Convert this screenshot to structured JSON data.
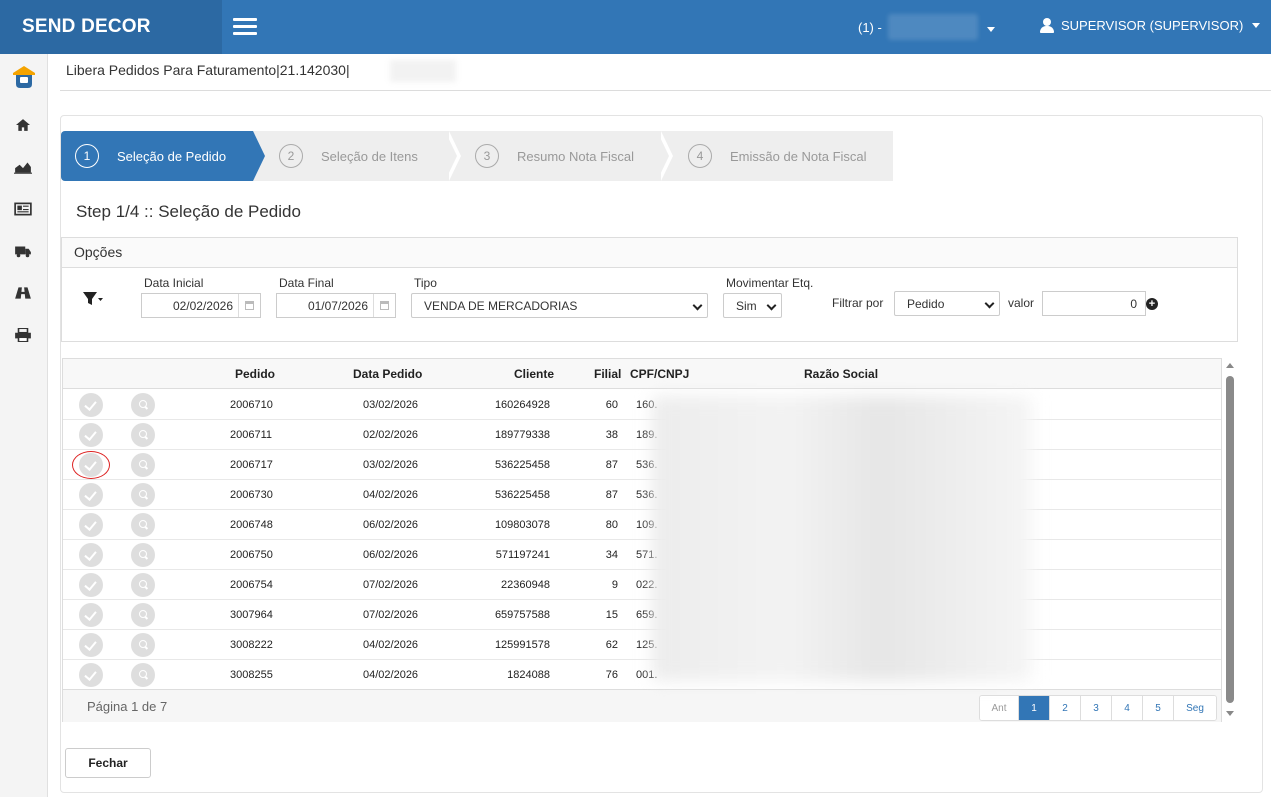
{
  "app": {
    "brand": "SEND DECOR"
  },
  "header": {
    "company_prefix": "(1) -",
    "user": "SUPERVISOR (SUPERVISOR)"
  },
  "page": {
    "title": "Libera Pedidos Para Faturamento|21.142030|"
  },
  "wizard": {
    "steps": [
      {
        "num": "1",
        "label": "Seleção de Pedido",
        "active": true
      },
      {
        "num": "2",
        "label": "Seleção de Itens",
        "active": false
      },
      {
        "num": "3",
        "label": "Resumo Nota Fiscal",
        "active": false
      },
      {
        "num": "4",
        "label": "Emissão de Nota Fiscal",
        "active": false
      }
    ],
    "heading": "Step 1/4 :: Seleção de Pedido"
  },
  "options": {
    "title": "Opções",
    "data_inicial_label": "Data Inicial",
    "data_inicial": "02/02/2026",
    "data_final_label": "Data Final",
    "data_final": "01/07/2026",
    "tipo_label": "Tipo",
    "tipo": "VENDA DE MERCADORIAS",
    "movimentar_label": "Movimentar Etq.",
    "movimentar": "Sim",
    "filtrar_label": "Filtrar por",
    "filtrar": "Pedido",
    "valor_label": "valor",
    "valor": "0"
  },
  "table": {
    "columns": [
      "Pedido",
      "Data Pedido",
      "Cliente",
      "Filial",
      "CPF/CNPJ",
      "Razão Social"
    ],
    "rows": [
      {
        "pedido": "2006710",
        "data": "03/02/2026",
        "cliente": "160264928",
        "filial": "60",
        "cpf": "160."
      },
      {
        "pedido": "2006711",
        "data": "02/02/2026",
        "cliente": "189779338",
        "filial": "38",
        "cpf": "189."
      },
      {
        "pedido": "2006717",
        "data": "03/02/2026",
        "cliente": "536225458",
        "filial": "87",
        "cpf": "536."
      },
      {
        "pedido": "2006730",
        "data": "04/02/2026",
        "cliente": "536225458",
        "filial": "87",
        "cpf": "536."
      },
      {
        "pedido": "2006748",
        "data": "06/02/2026",
        "cliente": "109803078",
        "filial": "80",
        "cpf": "109."
      },
      {
        "pedido": "2006750",
        "data": "06/02/2026",
        "cliente": "571197241",
        "filial": "34",
        "cpf": "571."
      },
      {
        "pedido": "2006754",
        "data": "07/02/2026",
        "cliente": "22360948",
        "filial": "9",
        "cpf": "022."
      },
      {
        "pedido": "3007964",
        "data": "07/02/2026",
        "cliente": "659757588",
        "filial": "15",
        "cpf": "659."
      },
      {
        "pedido": "3008222",
        "data": "04/02/2026",
        "cliente": "125991578",
        "filial": "62",
        "cpf": "125."
      },
      {
        "pedido": "3008255",
        "data": "04/02/2026",
        "cliente": "1824088",
        "filial": "76",
        "cpf": "001."
      }
    ],
    "page_info": "Página 1 de 7",
    "pager": [
      "Ant",
      "1",
      "2",
      "3",
      "4",
      "5",
      "Seg"
    ]
  },
  "footer": {
    "close_label": "Fechar"
  },
  "colors": {
    "primary": "#3276b6",
    "brand_dark": "#2c69a3"
  }
}
